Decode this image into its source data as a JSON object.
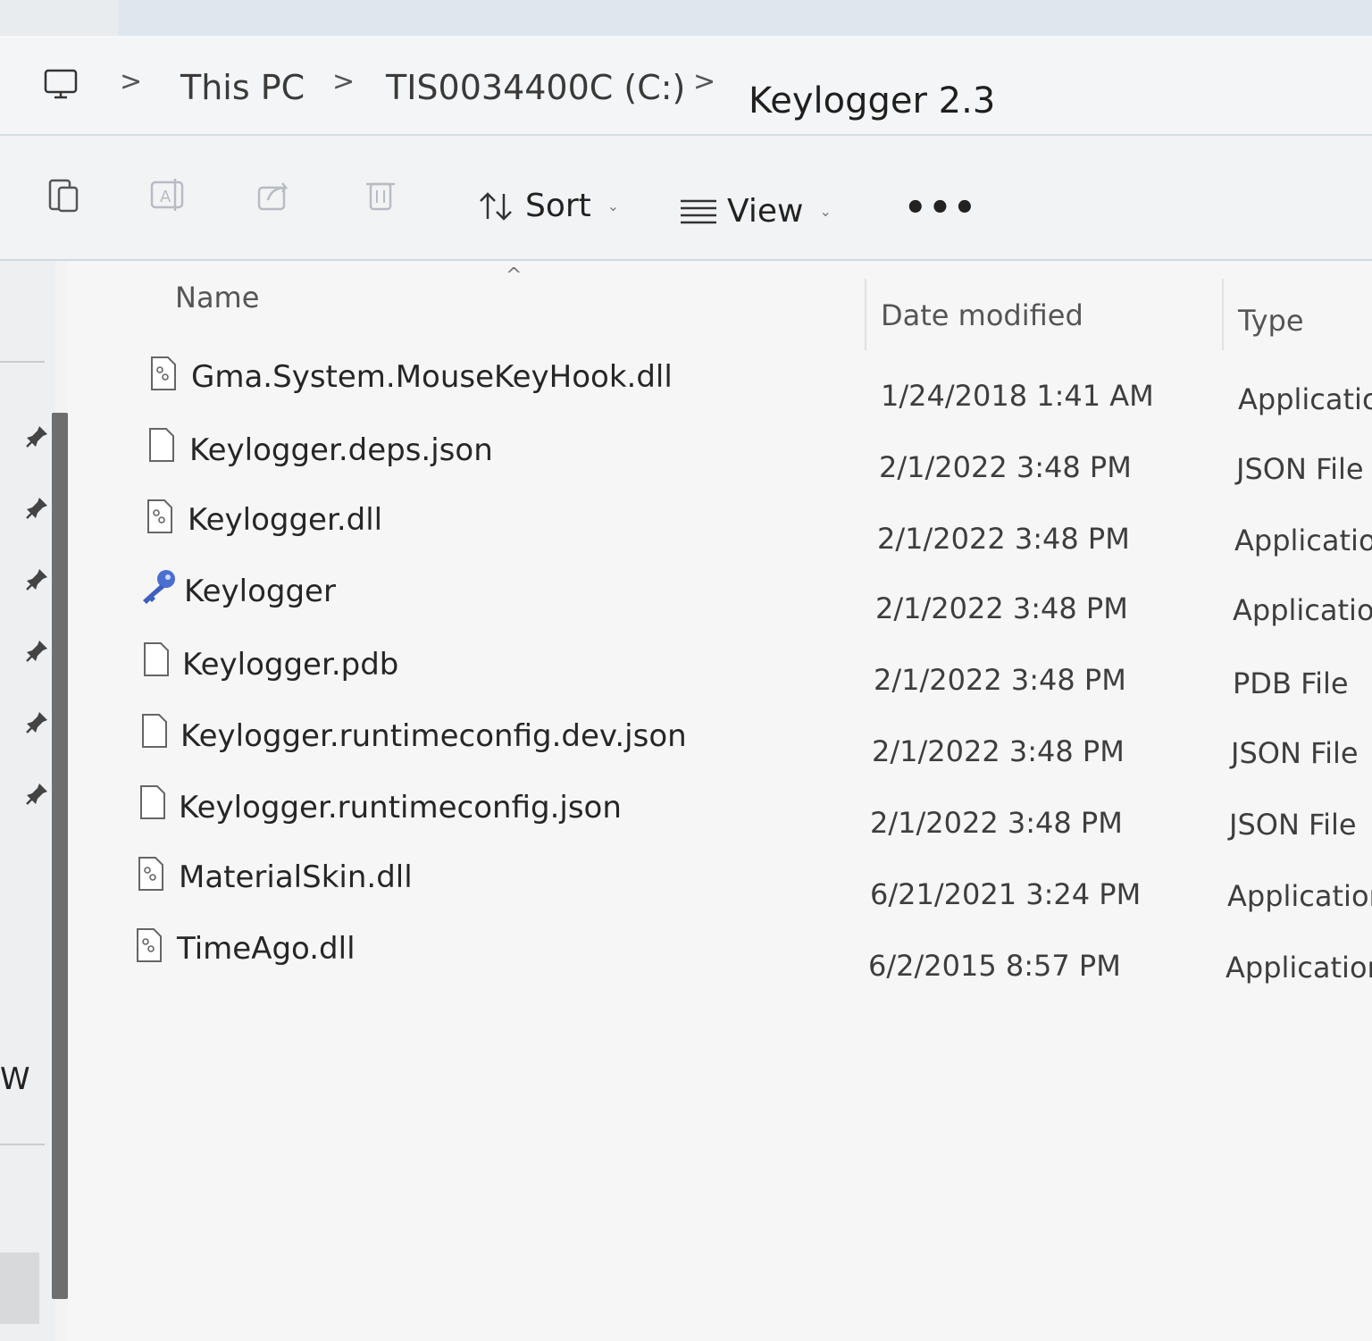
{
  "breadcrumb": {
    "items": [
      "This PC",
      "TIS0034400C (C:)",
      "Keylogger 2.3"
    ],
    "separator": ">"
  },
  "toolbar": {
    "sort_label": "Sort",
    "view_label": "View",
    "more_label": "•••"
  },
  "columns": {
    "name": "Name",
    "date": "Date modified",
    "type": "Type"
  },
  "files": [
    {
      "name": "Gma.System.MouseKeyHook.dll",
      "date": "1/24/2018 1:41 AM",
      "type": "Applicatio",
      "icon": "dll-file-icon"
    },
    {
      "name": "Keylogger.deps.json",
      "date": "2/1/2022 3:48 PM",
      "type": "JSON File",
      "icon": "blank-file-icon"
    },
    {
      "name": "Keylogger.dll",
      "date": "2/1/2022 3:48 PM",
      "type": "Applicatio",
      "icon": "dll-file-icon"
    },
    {
      "name": "Keylogger",
      "date": "2/1/2022 3:48 PM",
      "type": "Applicatio",
      "icon": "key-app-icon"
    },
    {
      "name": "Keylogger.pdb",
      "date": "2/1/2022 3:48 PM",
      "type": "PDB File",
      "icon": "blank-file-icon"
    },
    {
      "name": "Keylogger.runtimeconfig.dev.json",
      "date": "2/1/2022 3:48 PM",
      "type": "JSON File",
      "icon": "blank-file-icon"
    },
    {
      "name": "Keylogger.runtimeconfig.json",
      "date": "2/1/2022 3:48 PM",
      "type": "JSON File",
      "icon": "blank-file-icon"
    },
    {
      "name": "MaterialSkin.dll",
      "date": "6/21/2021 3:24 PM",
      "type": "Application",
      "icon": "dll-file-icon"
    },
    {
      "name": "TimeAgo.dll",
      "date": "6/2/2015 8:57 PM",
      "type": "Application",
      "icon": "dll-file-icon"
    }
  ],
  "nav": {
    "partial_label": "W"
  }
}
